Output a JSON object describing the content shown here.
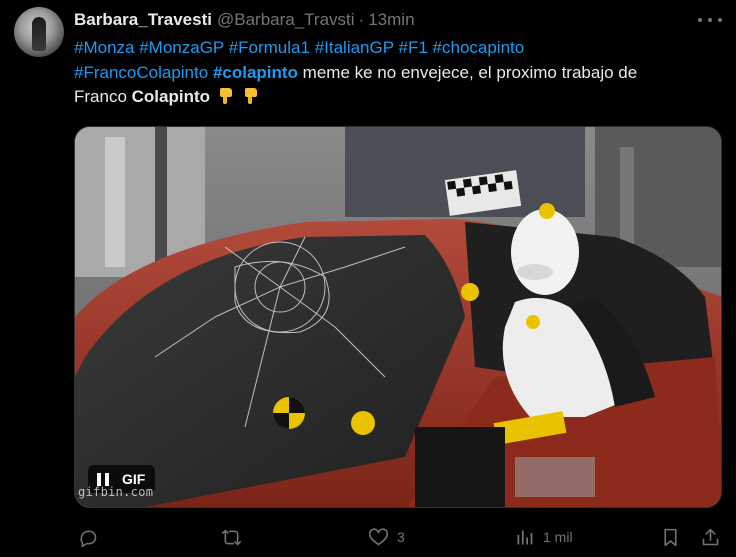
{
  "author": {
    "name": "Barbara_Travesti",
    "handle": "@Barbara_Travsti",
    "separator": "·",
    "time": "13min"
  },
  "tweet": {
    "hashtags": [
      "#Monza",
      "#MonzaGP",
      "#Formula1",
      "#ItalianGP",
      "#F1",
      "#chocapinto",
      "#FrancoColapinto",
      "#colapinto"
    ],
    "text_after_tags": " meme ke no envejece, el proximo trabajo de",
    "text_line3": "Franco ",
    "text_bold": "Colapinto",
    "emojis": [
      "backhand-index-pointing-down",
      "backhand-index-pointing-down"
    ]
  },
  "media": {
    "gif_label": "GIF",
    "watermark": "gifbin.com",
    "description_icons": [
      "crash-test-dummy",
      "red-car",
      "shattered-windshield"
    ]
  },
  "actions": {
    "reply_count": "",
    "retweet_count": "",
    "like_count": "3",
    "views_count": "1 mil"
  },
  "colors": {
    "background": "#000000",
    "text": "#e7e9ea",
    "muted": "#71767b",
    "link": "#1d9bf0"
  }
}
